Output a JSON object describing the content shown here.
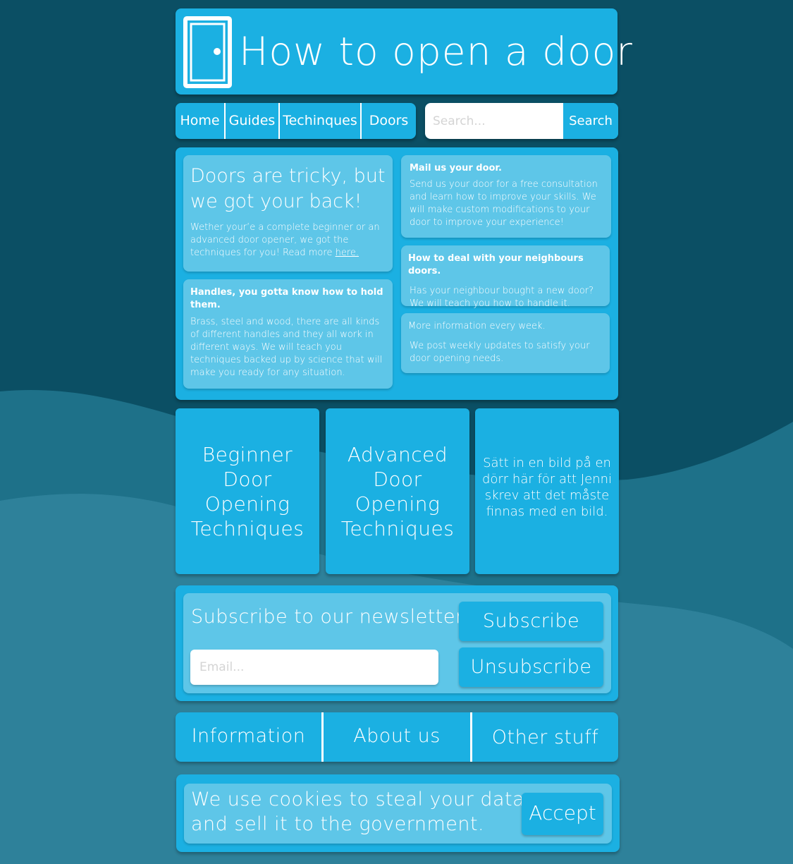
{
  "header": {
    "title": "How to open a door",
    "logo_icon": "door-icon"
  },
  "nav": {
    "items": [
      "Home",
      "Guides",
      "Techinques",
      "Doors"
    ]
  },
  "search": {
    "placeholder": "Search...",
    "button_label": "Search"
  },
  "main": {
    "hero": {
      "title": "Doors are tricky, but we got your back!",
      "text": "Wether your’e a complete beginner or an advanced door opener, we got the techniques for you! Read more ",
      "link_text": "here."
    },
    "handles": {
      "title": "Handles, you gotta know how to hold them.",
      "text": "Brass, steel and wood, there are all kinds of different handles and they all work in different ways. We will teach you techniques backed up by science that will make you ready for any situation."
    },
    "mail": {
      "title": "Mail us your door.",
      "text": "Send us your door for a free consultation and learn how to improve your skills. We will make custom modifications to your door to improve your experience!"
    },
    "neighbours": {
      "title": "How to deal with your neighbours doors.",
      "text": "Has your neighbour bought a new door? We will teach you how to handle it."
    },
    "info": {
      "title": "More information every week.",
      "text": "We post weekly updates to satisfy your door opening needs."
    }
  },
  "tiles": {
    "beginner": "Beginner Door Opening Techniques",
    "advanced": "Advanced Door Opening Techniques",
    "photo_placeholder": "Sätt in en bild på en dörr här för att Jenni skrev att det måste finnas med en bild."
  },
  "newsletter": {
    "title": "Subscribe to our newsletter",
    "email_placeholder": "Email...",
    "subscribe_label": "Subscribe",
    "unsubscribe_label": "Unsubscribe"
  },
  "footer": {
    "links": [
      "Information",
      "About us",
      "Other stuff"
    ]
  },
  "cookie": {
    "line1": "We use cookies to steal your data",
    "line2": "and sell it to the government.",
    "accept_label": "Accept"
  },
  "colors": {
    "background_dark": "#0b4f64",
    "wave_1": "#1e7189",
    "wave_2": "#2e819a",
    "panel": "#1bb0e2",
    "card": "#5ec6e8",
    "text": "#ffffff"
  }
}
